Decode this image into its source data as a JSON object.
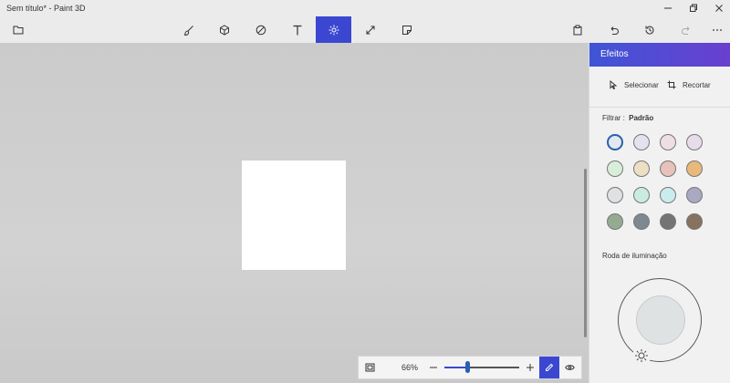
{
  "window": {
    "title": "Sem título* - Paint 3D"
  },
  "toolbar": {
    "active_tool": "effects",
    "tools": [
      "brushes",
      "3d-shapes",
      "2d-shapes",
      "text",
      "effects",
      "canvas",
      "stickers"
    ],
    "accent": "#3b47d0"
  },
  "zoom": {
    "label": "66%",
    "level_fraction": 0.3
  },
  "panel": {
    "title": "Efeitos",
    "select_label": "Selecionar",
    "crop_label": "Recortar",
    "filter_prefix": "Filtrar :",
    "filter_value": "Padrão",
    "lighting_label": "Roda de iluminação",
    "swatches": [
      "#e2e8ef",
      "#e3e2ee",
      "#eedee6",
      "#e7dcea",
      "#d7efd9",
      "#ece0c4",
      "#e6c2ba",
      "#e8b97a",
      "#dfe1e3",
      "#c9ebe2",
      "#cbecec",
      "#a9a9c2",
      "#94ab92",
      "#7d8891",
      "#747475",
      "#87715f"
    ]
  }
}
